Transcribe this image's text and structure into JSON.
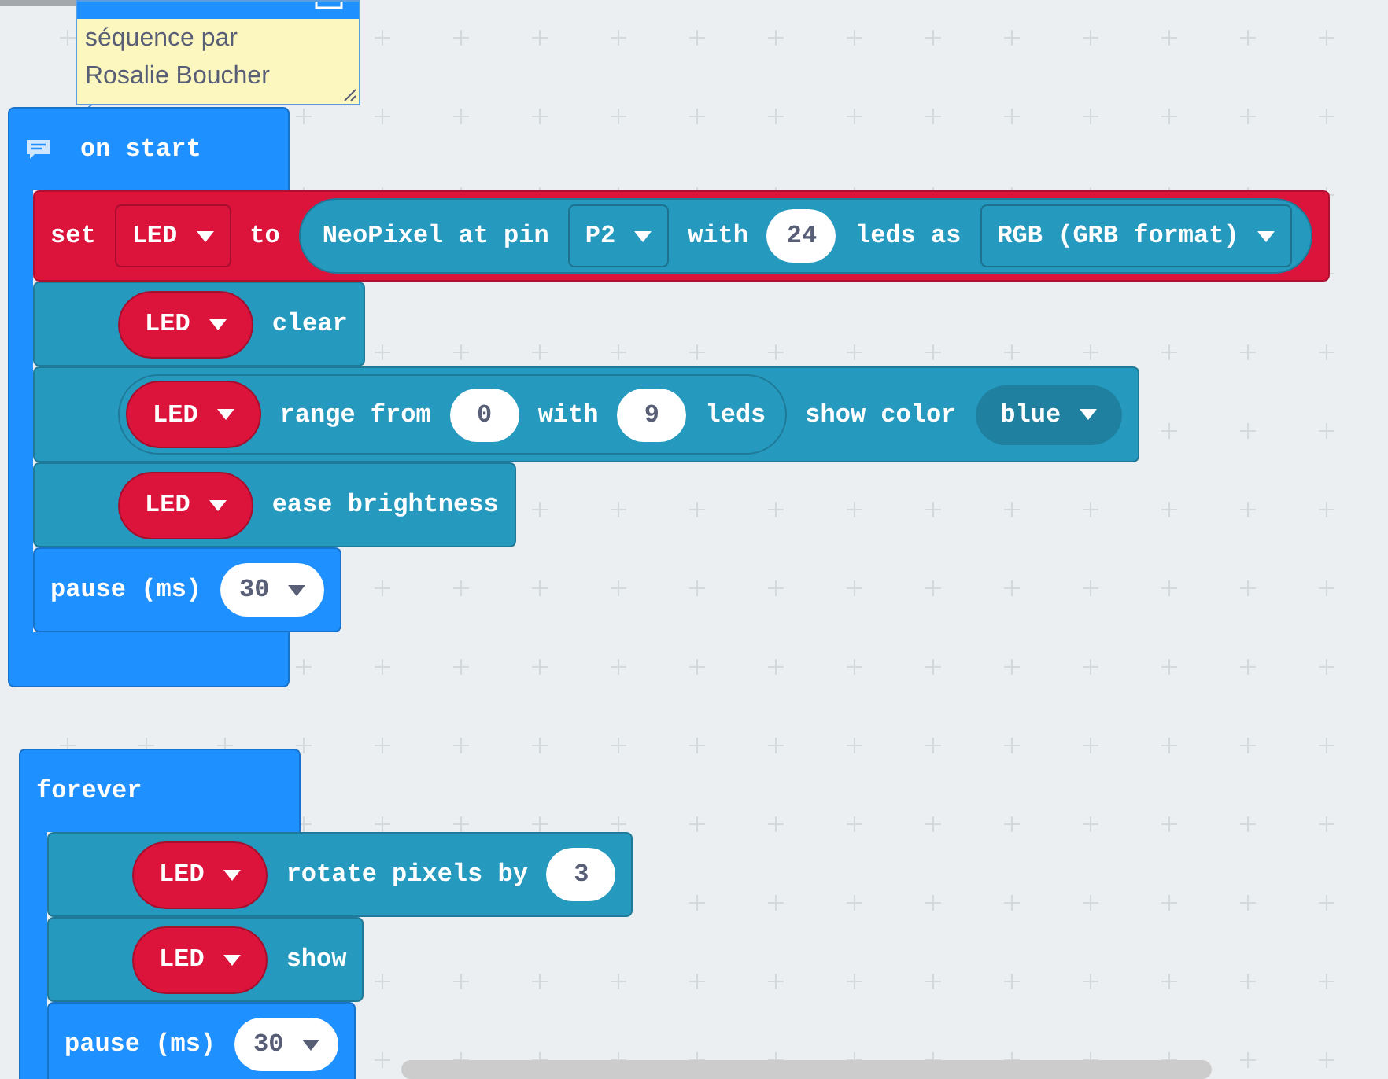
{
  "comment": {
    "text": "séquence par Rosalie Boucher"
  },
  "stacks": [
    {
      "label": "on start",
      "has_comment": true,
      "cut_off": false,
      "blocks": [
        {
          "color": "#dc143c",
          "parts": [
            {
              "kind": "text",
              "text": "set"
            },
            {
              "kind": "dropdown",
              "value": "LED"
            },
            {
              "kind": "text",
              "text": "to"
            },
            {
              "kind": "reporter",
              "color": "#2699bf",
              "parts": [
                {
                  "kind": "text",
                  "text": "NeoPixel at pin"
                },
                {
                  "kind": "dropdown",
                  "value": "P2"
                },
                {
                  "kind": "text",
                  "text": "with"
                },
                {
                  "kind": "number",
                  "value": "24"
                },
                {
                  "kind": "text",
                  "text": "leds as"
                },
                {
                  "kind": "dropdown",
                  "value": "RGB (GRB format)"
                }
              ]
            }
          ]
        },
        {
          "color": "#2699bf",
          "parts": [
            {
              "kind": "variable",
              "value": "LED"
            },
            {
              "kind": "text",
              "text": "clear"
            }
          ]
        },
        {
          "color": "#2699bf",
          "parts": [
            {
              "kind": "reporter",
              "color": "#2699bf",
              "parts": [
                {
                  "kind": "variable",
                  "value": "LED"
                },
                {
                  "kind": "text",
                  "text": "range from"
                },
                {
                  "kind": "number",
                  "value": "0"
                },
                {
                  "kind": "text",
                  "text": "with"
                },
                {
                  "kind": "number",
                  "value": "9"
                },
                {
                  "kind": "text",
                  "text": "leds"
                }
              ]
            },
            {
              "kind": "text",
              "text": "show color"
            },
            {
              "kind": "shadow_dropdown",
              "value": "blue"
            }
          ]
        },
        {
          "color": "#2699bf",
          "parts": [
            {
              "kind": "variable",
              "value": "LED"
            },
            {
              "kind": "text",
              "text": "ease brightness"
            }
          ]
        },
        {
          "color": "#1e90ff",
          "parts": [
            {
              "kind": "text",
              "text": "pause (ms)"
            },
            {
              "kind": "number_dropdown",
              "value": "30"
            }
          ]
        }
      ]
    },
    {
      "label": "forever",
      "has_comment": false,
      "cut_off": true,
      "blocks": [
        {
          "color": "#2699bf",
          "parts": [
            {
              "kind": "variable",
              "value": "LED"
            },
            {
              "kind": "text",
              "text": "rotate pixels by"
            },
            {
              "kind": "number",
              "value": "3"
            }
          ]
        },
        {
          "color": "#2699bf",
          "parts": [
            {
              "kind": "variable",
              "value": "LED"
            },
            {
              "kind": "text",
              "text": "show"
            }
          ]
        },
        {
          "color": "#1e90ff",
          "parts": [
            {
              "kind": "text",
              "text": "pause (ms)"
            },
            {
              "kind": "number_dropdown",
              "value": "30"
            }
          ]
        }
      ]
    }
  ]
}
